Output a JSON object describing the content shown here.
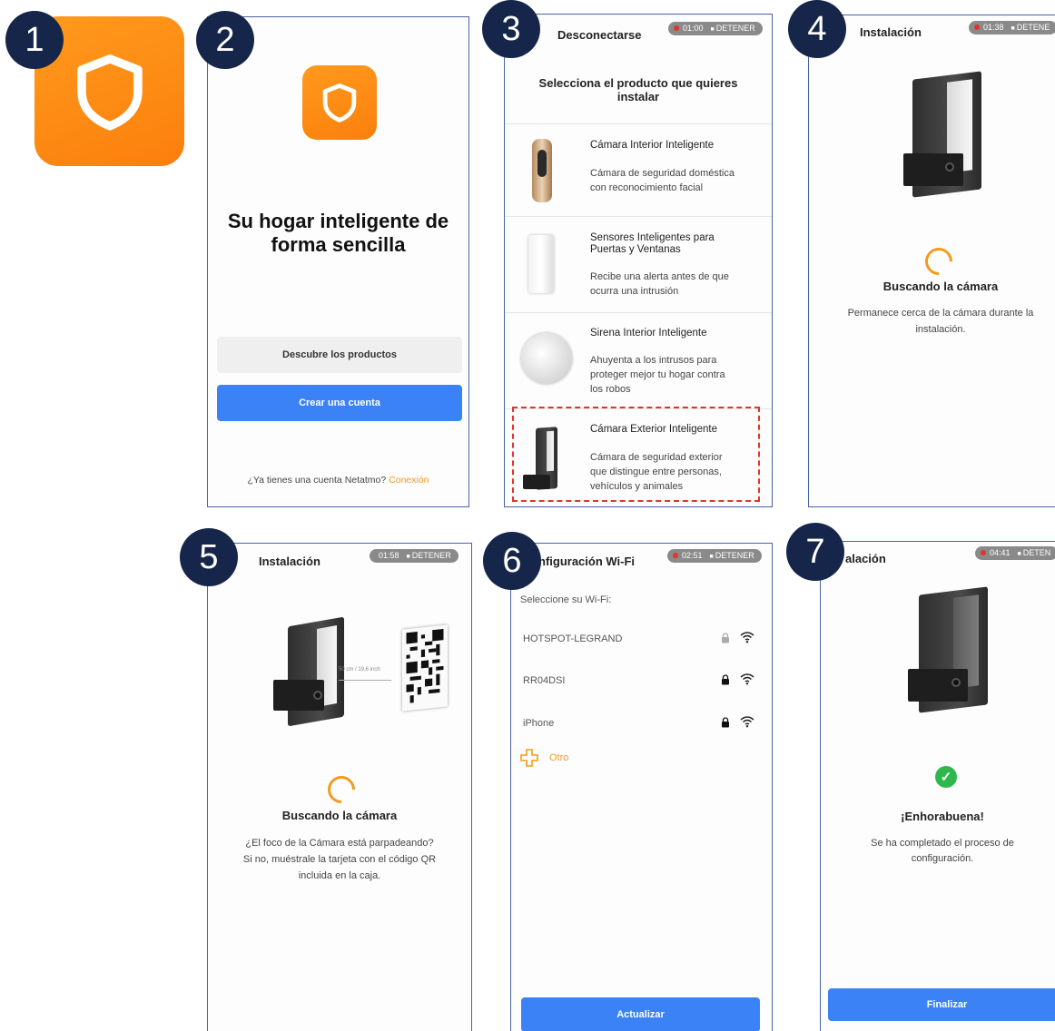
{
  "badges": [
    "1",
    "2",
    "3",
    "4",
    "5",
    "6",
    "7"
  ],
  "colors": {
    "orange": "#fb8a13",
    "blue": "#3b82f6",
    "badge": "#16264a",
    "screen_border": "#4a63a8",
    "dashed": "#e0342a",
    "green": "#2eb84c"
  },
  "app_icon": {
    "icon": "shield-icon"
  },
  "screen2": {
    "headline_line1": "Su hogar inteligente de",
    "headline_line2": "forma sencilla",
    "discover_button": "Descubre los productos",
    "create_account_button": "Crear una cuenta",
    "have_account_text": "¿Ya tienes una cuenta Netatmo?",
    "login_link": "Conexión"
  },
  "screen3": {
    "topbar_title": "Desconectarse",
    "rec_time": "01:00",
    "rec_stop": "DETENER",
    "heading_line1": "Selecciona el producto que quieres",
    "heading_line2": "instalar",
    "products": [
      {
        "title": "Cámara Interior Inteligente",
        "desc_line1": "Cámara de seguridad doméstica",
        "desc_line2": "con reconocimiento facial",
        "desc_line3": ""
      },
      {
        "title_line1": "Sensores Inteligentes para",
        "title_line2": "Puertas y Ventanas",
        "desc_line1": "Recibe una alerta antes de que",
        "desc_line2": "ocurra una intrusión",
        "desc_line3": ""
      },
      {
        "title": "Sirena Interior Inteligente",
        "desc_line1": "Ahuyenta a los intrusos para",
        "desc_line2": "proteger mejor tu hogar contra",
        "desc_line3": "los robos"
      },
      {
        "title": "Cámara Exterior Inteligente",
        "desc_line1": "Cámara de seguridad exterior",
        "desc_line2": "que distingue entre personas,",
        "desc_line3": "vehículos y animales"
      }
    ]
  },
  "screen4": {
    "topbar_title": "Instalación",
    "rec_time": "01:38",
    "rec_stop": "DETENE",
    "status_title": "Buscando la cámara",
    "hint_line1": "Permanece cerca de la cámara durante la",
    "hint_line2": "instalación."
  },
  "screen5": {
    "topbar_title": "Instalación",
    "rec_time": "01:58",
    "rec_stop": "DETENER",
    "distance_label": "50 cm / 19,6 inch",
    "status_title": "Buscando la cámara",
    "hint_line1": "¿El foco de la Cámara está parpadeando?",
    "hint_line2": "Si no, muéstrale la tarjeta con el código QR",
    "hint_line3": "incluida en la caja."
  },
  "screen6": {
    "topbar_title": "nfiguración Wi-Fi",
    "rec_time": "02:51",
    "rec_stop": "DETENER",
    "select_label": "Seleccione su Wi-Fi:",
    "networks": [
      {
        "name": "HOTSPOT-LEGRAND",
        "lock": "lock-open-grey"
      },
      {
        "name": "RR04DSI",
        "lock": "lock-closed-black"
      },
      {
        "name": "iPhone",
        "lock": "lock-closed-black"
      }
    ],
    "other_label": "Otro",
    "update_button": "Actualizar"
  },
  "screen7": {
    "topbar_title": "alación",
    "rec_time": "04:41",
    "rec_stop": "DETEN",
    "success_title": "¡Enhorabuena!",
    "success_line1": "Se ha completado el proceso de",
    "success_line2": "configuración.",
    "finish_button": "Finalizar"
  }
}
